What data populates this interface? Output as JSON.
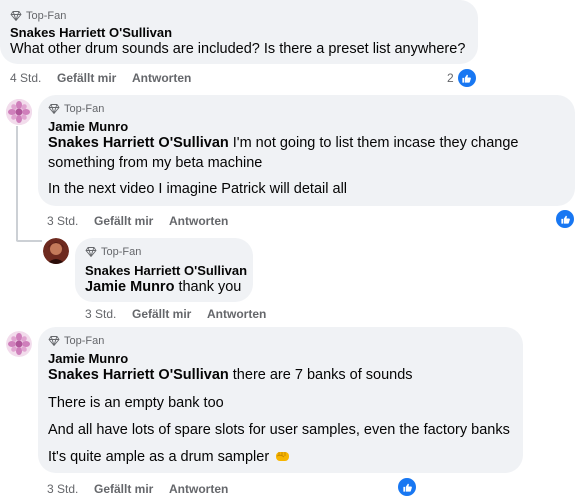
{
  "icons": {
    "badge": "diamond-icon",
    "like": "thumbs-up-icon",
    "emoji": "fist-emoji-icon"
  },
  "colors": {
    "bubble": "#f0f2f5",
    "like_blue": "#1877f2",
    "meta_gray": "#65676b",
    "avatar_pink": "#d8a6c9",
    "avatar_red": "#8b2a1e"
  },
  "comments": [
    {
      "badge": "Top-Fan",
      "author": "Snakes Harriett O'Sullivan",
      "lines": [
        "What other drum sounds are included? Is there a preset list anywhere?"
      ],
      "time": "4 Std.",
      "like_label": "Gefällt mir",
      "reply_label": "Antworten",
      "like_count": "2"
    },
    {
      "badge": "Top-Fan",
      "author": "Jamie Munro",
      "mention": "Snakes Harriett O'Sullivan",
      "lines": [
        "I'm not going to list them incase they change",
        "something from my beta machine",
        "In the next video I imagine Patrick will detail all"
      ],
      "time": "3 Std.",
      "like_label": "Gefällt mir",
      "reply_label": "Antworten"
    },
    {
      "badge": "Top-Fan",
      "author": "Snakes Harriett O'Sullivan",
      "mention": "Jamie Munro",
      "lines": [
        "thank you"
      ],
      "time": "3 Std.",
      "like_label": "Gefällt mir",
      "reply_label": "Antworten"
    },
    {
      "badge": "Top-Fan",
      "author": "Jamie Munro",
      "mention": "Snakes Harriett O'Sullivan",
      "lines": [
        "there are 7 banks of sounds",
        "There is an empty bank too",
        "And all have lots of spare slots for user samples, even the factory banks",
        "It's quite ample as a drum sampler"
      ],
      "time": "3 Std.",
      "like_label": "Gefällt mir",
      "reply_label": "Antworten"
    }
  ]
}
